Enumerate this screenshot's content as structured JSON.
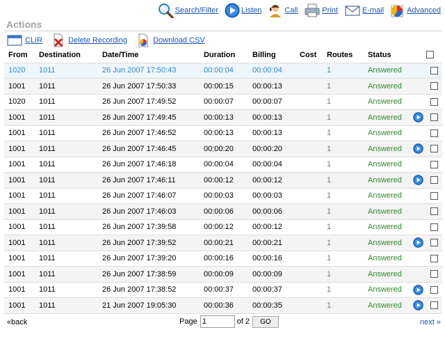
{
  "toolbar": {
    "search_label": "Search/Filter",
    "listen_label": "Listen",
    "call_label": "Call",
    "print_label": "Print",
    "email_label": "E-mail",
    "advanced_label": "Advanced"
  },
  "heading": "Actions",
  "actions": {
    "clir_label": "CLIR",
    "delete_label": "Delete Recording",
    "download_label": "Download CSV"
  },
  "columns": {
    "from": "From",
    "destination": "Destination",
    "datetime": "Date/Time",
    "duration": "Duration",
    "billing": "Billing",
    "cost": "Cost",
    "routes": "Routes",
    "status": "Status"
  },
  "rows": [
    {
      "from": "1020",
      "destination": "1011",
      "datetime": "26 Jun 2007 17:50:43",
      "duration": "00:00:04",
      "billing": "00:00:04",
      "cost": "",
      "routes": "1",
      "status": "Answered",
      "has_recording": false,
      "selected": true
    },
    {
      "from": "1001",
      "destination": "1011",
      "datetime": "26 Jun 2007 17:50:33",
      "duration": "00:00:15",
      "billing": "00:00:13",
      "cost": "",
      "routes": "1",
      "status": "Answered",
      "has_recording": false,
      "selected": false
    },
    {
      "from": "1020",
      "destination": "1011",
      "datetime": "26 Jun 2007 17:49:52",
      "duration": "00:00:07",
      "billing": "00:00:07",
      "cost": "",
      "routes": "1",
      "status": "Answered",
      "has_recording": false,
      "selected": false
    },
    {
      "from": "1001",
      "destination": "1011",
      "datetime": "26 Jun 2007 17:49:45",
      "duration": "00:00:13",
      "billing": "00:00:13",
      "cost": "",
      "routes": "1",
      "status": "Answered",
      "has_recording": true,
      "selected": false
    },
    {
      "from": "1001",
      "destination": "1011",
      "datetime": "26 Jun 2007 17:46:52",
      "duration": "00:00:13",
      "billing": "00:00:13",
      "cost": "",
      "routes": "1",
      "status": "Answered",
      "has_recording": false,
      "selected": false
    },
    {
      "from": "1001",
      "destination": "1011",
      "datetime": "26 Jun 2007 17:46:45",
      "duration": "00:00:20",
      "billing": "00:00:20",
      "cost": "",
      "routes": "1",
      "status": "Answered",
      "has_recording": true,
      "selected": false
    },
    {
      "from": "1001",
      "destination": "1011",
      "datetime": "26 Jun 2007 17:46:18",
      "duration": "00:00:04",
      "billing": "00:00:04",
      "cost": "",
      "routes": "1",
      "status": "Answered",
      "has_recording": false,
      "selected": false
    },
    {
      "from": "1001",
      "destination": "1011",
      "datetime": "26 Jun 2007 17:46:11",
      "duration": "00:00:12",
      "billing": "00:00:12",
      "cost": "",
      "routes": "1",
      "status": "Answered",
      "has_recording": true,
      "selected": false
    },
    {
      "from": "1001",
      "destination": "1011",
      "datetime": "26 Jun 2007 17:46:07",
      "duration": "00:00:03",
      "billing": "00:00:03",
      "cost": "",
      "routes": "1",
      "status": "Answered",
      "has_recording": false,
      "selected": false
    },
    {
      "from": "1001",
      "destination": "1011",
      "datetime": "26 Jun 2007 17:46:03",
      "duration": "00:00:06",
      "billing": "00:00:06",
      "cost": "",
      "routes": "1",
      "status": "Answered",
      "has_recording": false,
      "selected": false
    },
    {
      "from": "1001",
      "destination": "1011",
      "datetime": "26 Jun 2007 17:39:58",
      "duration": "00:00:12",
      "billing": "00:00:12",
      "cost": "",
      "routes": "1",
      "status": "Answered",
      "has_recording": false,
      "selected": false
    },
    {
      "from": "1001",
      "destination": "1011",
      "datetime": "26 Jun 2007 17:39:52",
      "duration": "00:00:21",
      "billing": "00:00:21",
      "cost": "",
      "routes": "1",
      "status": "Answered",
      "has_recording": true,
      "selected": false
    },
    {
      "from": "1001",
      "destination": "1011",
      "datetime": "26 Jun 2007 17:39:20",
      "duration": "00:00:16",
      "billing": "00:00:16",
      "cost": "",
      "routes": "1",
      "status": "Answered",
      "has_recording": false,
      "selected": false
    },
    {
      "from": "1001",
      "destination": "1011",
      "datetime": "26 Jun 2007 17:38:59",
      "duration": "00:00:09",
      "billing": "00:00:09",
      "cost": "",
      "routes": "1",
      "status": "Answered",
      "has_recording": false,
      "selected": false
    },
    {
      "from": "1001",
      "destination": "1011",
      "datetime": "26 Jun 2007 17:38:52",
      "duration": "00:00:37",
      "billing": "00:00:37",
      "cost": "",
      "routes": "1",
      "status": "Answered",
      "has_recording": true,
      "selected": false
    },
    {
      "from": "1001",
      "destination": "1011",
      "datetime": "21 Jun 2007 19:05:30",
      "duration": "00:00:36",
      "billing": "00:00:35",
      "cost": "",
      "routes": "1",
      "status": "Answered",
      "has_recording": true,
      "selected": false
    }
  ],
  "pagination": {
    "back_label": "«back",
    "page_label": "Page",
    "current_page": "1",
    "of_label": "of 2",
    "go_label": "GO",
    "next_label": "next »"
  },
  "icons": {
    "search": "magnifier-icon",
    "listen": "play-icon",
    "call": "operator-icon",
    "print": "printer-icon",
    "email": "envelope-icon",
    "advanced": "pie-chart-icon",
    "clir": "window-icon",
    "delete": "delete-document-icon",
    "download": "csv-document-icon"
  },
  "colors": {
    "link": "#1a55b8",
    "answered": "#2d8a2d",
    "selected_text": "#2e89c8",
    "heading": "#a3a3a3"
  }
}
